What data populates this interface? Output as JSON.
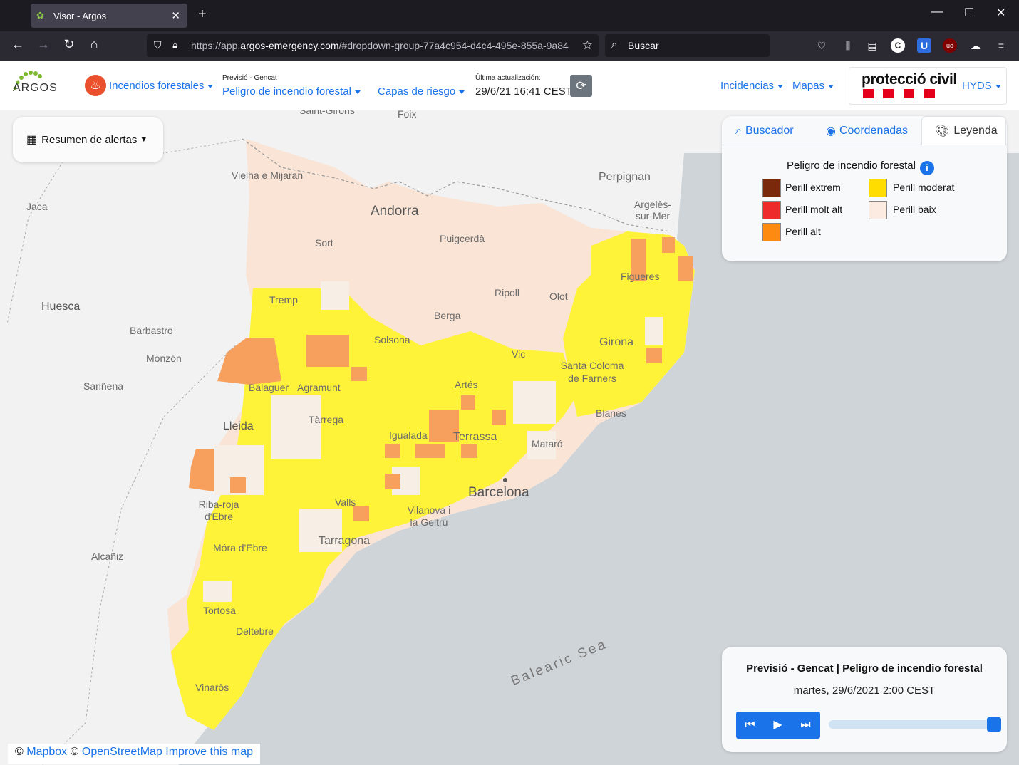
{
  "browser": {
    "tab_title": "Visor - Argos",
    "url_prefix": "https://app.",
    "url_host": "argos-emergency.com",
    "url_path": "/#dropdown-group-77a4c954-d4c4-495e-855a-9a84",
    "search_placeholder": "Buscar"
  },
  "header": {
    "logo_text": "ARGOS",
    "incendios": "Incendios forestales",
    "prevision_small": "Previsió - Gencat",
    "peligro": "Peligro de incendio forestal",
    "capas": "Capas de riesgo",
    "ultima_small": "Última actualización:",
    "ultima_value": "29/6/21 16:41 CEST",
    "incidencias": "Incidencias",
    "mapas": "Mapas",
    "pc_title": "protecció civil",
    "hyds": "HYDS"
  },
  "alerts": {
    "label": "Resumen de alertas"
  },
  "legend": {
    "tabs": [
      "Buscador",
      "Coordenadas",
      "Leyenda"
    ],
    "title": "Peligro de incendio forestal",
    "items": [
      {
        "label": "Perill extrem",
        "color": "#7a2a0a"
      },
      {
        "label": "Perill molt alt",
        "color": "#ee2a2a"
      },
      {
        "label": "Perill alt",
        "color": "#ff8a12"
      },
      {
        "label": "Perill moderat",
        "color": "#ffdd00"
      },
      {
        "label": "Perill baix",
        "color": "#fbebe0"
      }
    ]
  },
  "player": {
    "title": "Previsió - Gencat | Peligro de incendio forestal",
    "date": "martes, 29/6/2021 2:00 CEST",
    "progress": 1.0
  },
  "attribution": {
    "copy": "©",
    "mapbox": "Mapbox",
    "osm": "OpenStreetMap",
    "improve": "Improve this map"
  },
  "map_labels": [
    "Saint-Girons",
    "Foix",
    "Vielha e Mijaran",
    "Perpignan",
    "Jaca",
    "Andorra",
    "Argelès-sur-Mer",
    "Sort",
    "Puigcerdà",
    "Figueres",
    "Ripoll",
    "Olot",
    "Huesca",
    "Tremp",
    "Berga",
    "Barbastro",
    "Solsona",
    "Girona",
    "Monzón",
    "Vic",
    "Santa Coloma de Farners",
    "Sariñena",
    "Balaguer",
    "Agramunt",
    "Artés",
    "Blanes",
    "Tàrrega",
    "Lleida",
    "Igualada",
    "Terrassa",
    "Mataró",
    "Barcelona",
    "Valls",
    "Vilanova i la Geltrú",
    "Tarragona",
    "Móra d'Ebre",
    "Riba-roja d'Ebre",
    "Alcañiz",
    "Tortosa",
    "Deltebre",
    "Vinaròs",
    "Balearic Sea"
  ]
}
